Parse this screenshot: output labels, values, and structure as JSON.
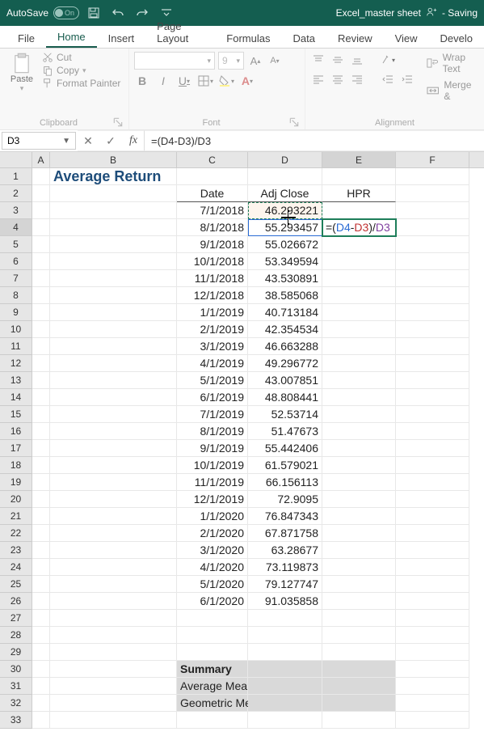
{
  "titlebar": {
    "autosave_label": "AutoSave",
    "autosave_state": "On",
    "doc_name": "Excel_master sheet",
    "saving_status": "Saving"
  },
  "ribbon_tabs": {
    "file": "File",
    "home": "Home",
    "insert": "Insert",
    "page_layout": "Page Layout",
    "formulas": "Formulas",
    "data": "Data",
    "review": "Review",
    "view": "View",
    "developer": "Develo"
  },
  "ribbon": {
    "clipboard": {
      "label": "Clipboard",
      "paste": "Paste",
      "cut": "Cut",
      "copy": "Copy",
      "format_painter": "Format Painter"
    },
    "font": {
      "label": "Font",
      "size": "9",
      "bold": "B",
      "italic": "I",
      "underline": "U"
    },
    "alignment": {
      "label": "Alignment",
      "wrap": "Wrap Text",
      "merge": "Merge &"
    }
  },
  "namebox": "D3",
  "formula_bar": "=(D4-D3)/D3",
  "sheet": {
    "title": "Average Return",
    "headers": {
      "date": "Date",
      "adj_close": "Adj Close",
      "hpr": "HPR"
    },
    "rows": [
      {
        "date": "7/1/2018",
        "adj": "46.293221"
      },
      {
        "date": "8/1/2018",
        "adj": "55.293457"
      },
      {
        "date": "9/1/2018",
        "adj": "55.026672"
      },
      {
        "date": "10/1/2018",
        "adj": "53.349594"
      },
      {
        "date": "11/1/2018",
        "adj": "43.530891"
      },
      {
        "date": "12/1/2018",
        "adj": "38.585068"
      },
      {
        "date": "1/1/2019",
        "adj": "40.713184"
      },
      {
        "date": "2/1/2019",
        "adj": "42.354534"
      },
      {
        "date": "3/1/2019",
        "adj": "46.663288"
      },
      {
        "date": "4/1/2019",
        "adj": "49.296772"
      },
      {
        "date": "5/1/2019",
        "adj": "43.007851"
      },
      {
        "date": "6/1/2019",
        "adj": "48.808441"
      },
      {
        "date": "7/1/2019",
        "adj": "52.53714"
      },
      {
        "date": "8/1/2019",
        "adj": "51.47673"
      },
      {
        "date": "9/1/2019",
        "adj": "55.442406"
      },
      {
        "date": "10/1/2019",
        "adj": "61.579021"
      },
      {
        "date": "11/1/2019",
        "adj": "66.156113"
      },
      {
        "date": "12/1/2019",
        "adj": "72.9095"
      },
      {
        "date": "1/1/2020",
        "adj": "76.847343"
      },
      {
        "date": "2/1/2020",
        "adj": "67.871758"
      },
      {
        "date": "3/1/2020",
        "adj": "63.28677"
      },
      {
        "date": "4/1/2020",
        "adj": "73.119873"
      },
      {
        "date": "5/1/2020",
        "adj": "79.127747"
      },
      {
        "date": "6/1/2020",
        "adj": "91.035858"
      }
    ],
    "formula_display_d3_masked": "46.2      221",
    "formula_entry": {
      "eq": "=(",
      "r1": "D4",
      "minus": "-",
      "r2": "D3",
      "close": ")/",
      "r3": "D3"
    },
    "summary": {
      "title": "Summary",
      "avg": "Average Mean Return",
      "geo": "Geometric Mean Return"
    }
  }
}
